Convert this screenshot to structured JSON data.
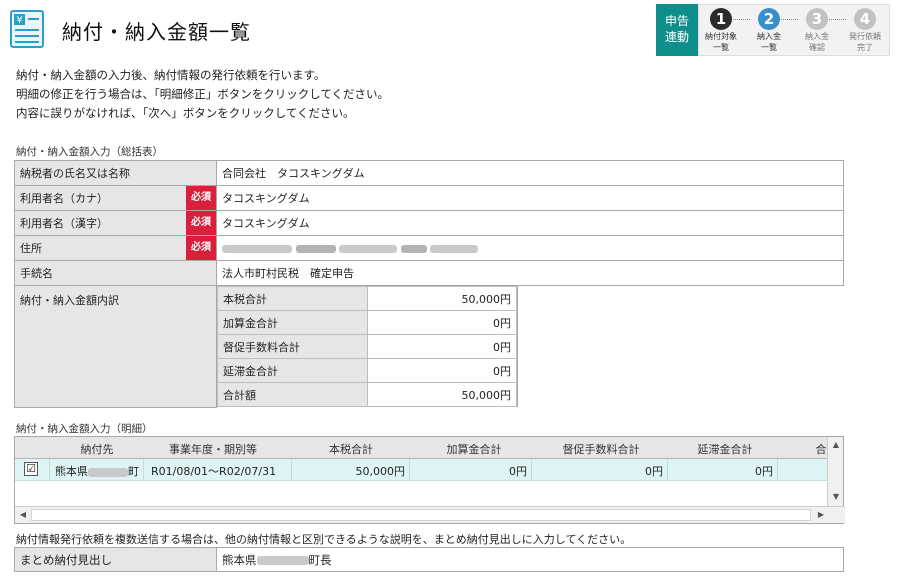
{
  "title": "納付・納入金額一覧",
  "stepper": {
    "badge_line1": "申告",
    "badge_line2": "連動",
    "steps": [
      {
        "number": "1",
        "label1": "納付対象",
        "label2": "一覧",
        "state": "done",
        "color": "#2b2b2b"
      },
      {
        "number": "2",
        "label1": "納入金",
        "label2": "一覧",
        "state": "current",
        "color": "#3a8fc9"
      },
      {
        "number": "3",
        "label1": "納入金",
        "label2": "確認",
        "state": "todo",
        "color": "#c2c2c2"
      },
      {
        "number": "4",
        "label1": "発行依頼",
        "label2": "完了",
        "state": "todo",
        "color": "#c2c2c2"
      }
    ]
  },
  "intro": [
    "納付・納入金額の入力後、納付情報の発行依頼を行います。",
    "明細の修正を行う場合は、「明細修正」ボタンをクリックしてください。",
    "内容に誤りがなければ、「次へ」ボタンをクリックしてください。"
  ],
  "summary": {
    "section_label": "納付・納入金額入力（総括表）",
    "required_label": "必須",
    "rows": [
      {
        "label": "納税者の氏名又は名称",
        "value": "合同会社　タコスキングダム",
        "required": false
      },
      {
        "label": "利用者名（カナ）",
        "value": "タコスキングダム",
        "required": true
      },
      {
        "label": "利用者名（漢字）",
        "value": "タコスキングダム",
        "required": true
      },
      {
        "label": "住所",
        "value": "",
        "required": true
      },
      {
        "label": "手続名",
        "value": "法人市町村民税　確定申告",
        "required": false
      }
    ],
    "breakdown_label": "納付・納入金額内訳",
    "breakdown": [
      {
        "label": "本税合計",
        "value": "50,000円"
      },
      {
        "label": "加算金合計",
        "value": "0円"
      },
      {
        "label": "督促手数料合計",
        "value": "0円"
      },
      {
        "label": "延滞金合計",
        "value": "0円"
      },
      {
        "label": "合計額",
        "value": "50,000円"
      }
    ]
  },
  "detail": {
    "section_label": "納付・納入金額入力（明細）",
    "headers": [
      "納付先",
      "事業年度・期別等",
      "本税合計",
      "加算金合計",
      "督促手数料合計",
      "延滞金合計",
      "合"
    ],
    "row": {
      "checked": "☑",
      "payee_prefix": "熊本県",
      "payee_suffix": "町",
      "period": "R01/08/01～R02/07/31",
      "tax": "50,000円",
      "surcharge": "0円",
      "fee": "0円",
      "delinquency": "0円"
    }
  },
  "note": "納付情報発行依頼を複数送信する場合は、他の納付情報と区別できるような説明を、まとめ納付見出しに入力してください。",
  "matome": {
    "label": "まとめ納付見出し",
    "value_prefix": "熊本県",
    "value_suffix": "町長"
  },
  "colors": {
    "accent_teal": "#0e8f8a",
    "required_red": "#d8203a",
    "selected_row": "#dff5f5"
  }
}
